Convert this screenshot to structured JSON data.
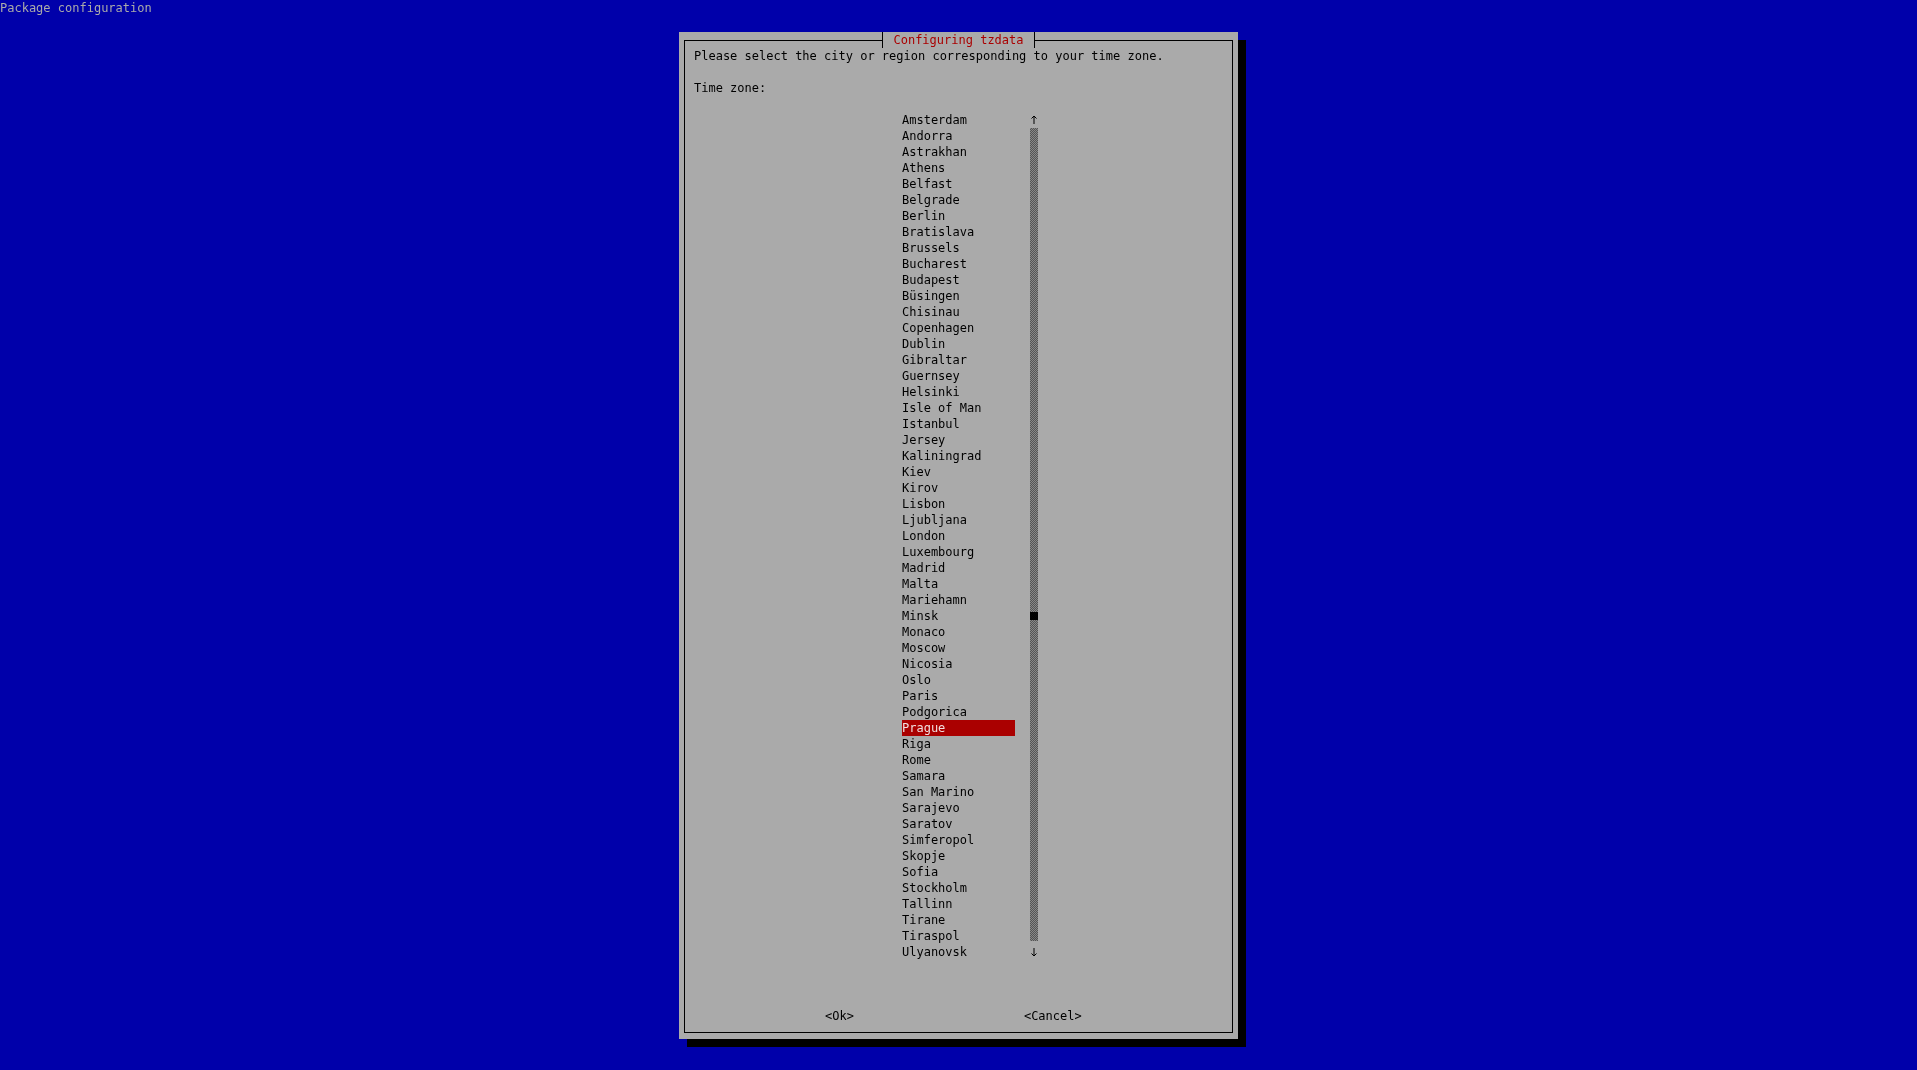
{
  "screen": {
    "title": "Package configuration"
  },
  "dialog": {
    "title": "Configuring tzdata",
    "prompt": "Please select the city or region corresponding to your time zone.",
    "label": "Time zone:",
    "items": [
      {
        "label": "Amsterdam",
        "selected": false
      },
      {
        "label": "Andorra",
        "selected": false
      },
      {
        "label": "Astrakhan",
        "selected": false
      },
      {
        "label": "Athens",
        "selected": false
      },
      {
        "label": "Belfast",
        "selected": false
      },
      {
        "label": "Belgrade",
        "selected": false
      },
      {
        "label": "Berlin",
        "selected": false
      },
      {
        "label": "Bratislava",
        "selected": false
      },
      {
        "label": "Brussels",
        "selected": false
      },
      {
        "label": "Bucharest",
        "selected": false
      },
      {
        "label": "Budapest",
        "selected": false
      },
      {
        "label": "Büsingen",
        "selected": false
      },
      {
        "label": "Chisinau",
        "selected": false
      },
      {
        "label": "Copenhagen",
        "selected": false
      },
      {
        "label": "Dublin",
        "selected": false
      },
      {
        "label": "Gibraltar",
        "selected": false
      },
      {
        "label": "Guernsey",
        "selected": false
      },
      {
        "label": "Helsinki",
        "selected": false
      },
      {
        "label": "Isle of Man",
        "selected": false
      },
      {
        "label": "Istanbul",
        "selected": false
      },
      {
        "label": "Jersey",
        "selected": false
      },
      {
        "label": "Kaliningrad",
        "selected": false
      },
      {
        "label": "Kiev",
        "selected": false
      },
      {
        "label": "Kirov",
        "selected": false
      },
      {
        "label": "Lisbon",
        "selected": false
      },
      {
        "label": "Ljubljana",
        "selected": false
      },
      {
        "label": "London",
        "selected": false
      },
      {
        "label": "Luxembourg",
        "selected": false
      },
      {
        "label": "Madrid",
        "selected": false
      },
      {
        "label": "Malta",
        "selected": false
      },
      {
        "label": "Mariehamn",
        "selected": false
      },
      {
        "label": "Minsk",
        "selected": false
      },
      {
        "label": "Monaco",
        "selected": false
      },
      {
        "label": "Moscow",
        "selected": false
      },
      {
        "label": "Nicosia",
        "selected": false
      },
      {
        "label": "Oslo",
        "selected": false
      },
      {
        "label": "Paris",
        "selected": false
      },
      {
        "label": "Podgorica",
        "selected": false
      },
      {
        "label": "Prague",
        "selected": true
      },
      {
        "label": "Riga",
        "selected": false
      },
      {
        "label": "Rome",
        "selected": false
      },
      {
        "label": "Samara",
        "selected": false
      },
      {
        "label": "San Marino",
        "selected": false
      },
      {
        "label": "Sarajevo",
        "selected": false
      },
      {
        "label": "Saratov",
        "selected": false
      },
      {
        "label": "Simferopol",
        "selected": false
      },
      {
        "label": "Skopje",
        "selected": false
      },
      {
        "label": "Sofia",
        "selected": false
      },
      {
        "label": "Stockholm",
        "selected": false
      },
      {
        "label": "Tallinn",
        "selected": false
      },
      {
        "label": "Tirane",
        "selected": false
      },
      {
        "label": "Tiraspol",
        "selected": false
      },
      {
        "label": "Ulyanovsk",
        "selected": false
      }
    ],
    "buttons": [
      {
        "label": "<Ok>"
      },
      {
        "label": "<Cancel>"
      }
    ]
  }
}
